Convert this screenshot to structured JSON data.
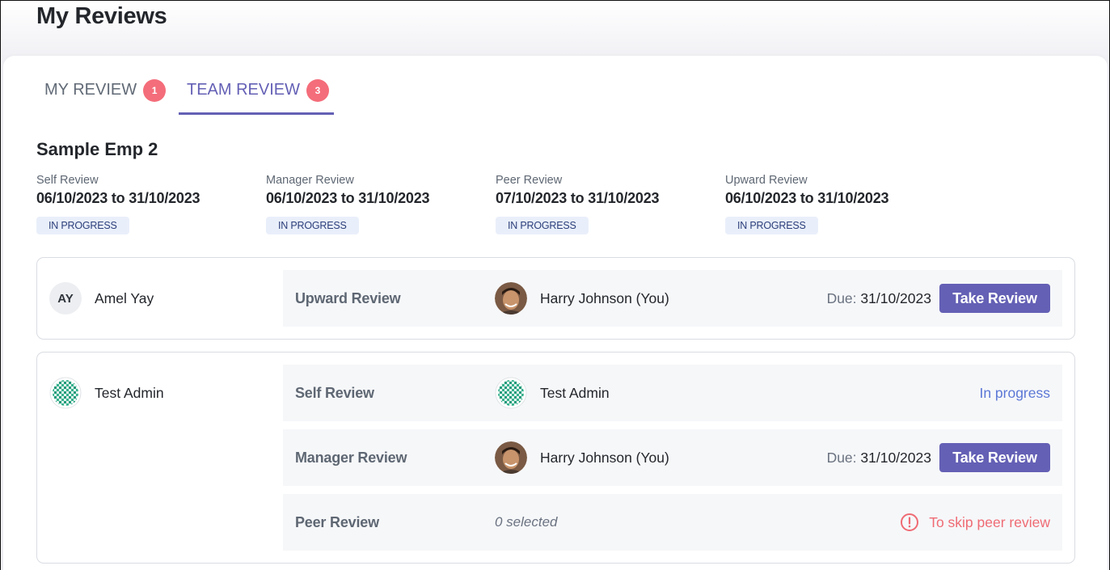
{
  "page": {
    "title": "My Reviews"
  },
  "tabs": [
    {
      "label": "MY REVIEW",
      "count": "1"
    },
    {
      "label": "TEAM REVIEW",
      "count": "3"
    }
  ],
  "employee": {
    "name": "Sample Emp 2",
    "periods": [
      {
        "label": "Self Review",
        "dates": "06/10/2023 to 31/10/2023",
        "status": "IN PROGRESS"
      },
      {
        "label": "Manager Review",
        "dates": "06/10/2023 to 31/10/2023",
        "status": "IN PROGRESS"
      },
      {
        "label": "Peer Review",
        "dates": "07/10/2023 to 31/10/2023",
        "status": "IN PROGRESS"
      },
      {
        "label": "Upward Review",
        "dates": "06/10/2023 to 31/10/2023",
        "status": "IN PROGRESS"
      }
    ]
  },
  "reviews": [
    {
      "reviewee": {
        "name": "Amel Yay",
        "initials": "AY"
      },
      "rows": [
        {
          "type": "Upward Review",
          "reviewer": "Harry Johnson (You)",
          "due_label": "Due:",
          "due_date": "31/10/2023",
          "action": "Take Review"
        }
      ]
    },
    {
      "reviewee": {
        "name": "Test Admin"
      },
      "rows": [
        {
          "type": "Self Review",
          "reviewer": "Test Admin",
          "status": "In progress"
        },
        {
          "type": "Manager Review",
          "reviewer": "Harry Johnson (You)",
          "due_label": "Due:",
          "due_date": "31/10/2023",
          "action": "Take Review"
        },
        {
          "type": "Peer Review",
          "selected": "0 selected",
          "skip_label": "To skip peer review"
        }
      ]
    }
  ],
  "colors": {
    "accent": "#6460b5",
    "badge": "#f46d7a",
    "link": "#5c78d6",
    "warning": "#ef6b74",
    "status_pill_bg": "#e9effa"
  },
  "icons": {
    "reviewer_avatar": "person-photo-avatar",
    "admin_avatar": "teal-pattern-avatar",
    "skip": "exclamation-circle-icon"
  }
}
